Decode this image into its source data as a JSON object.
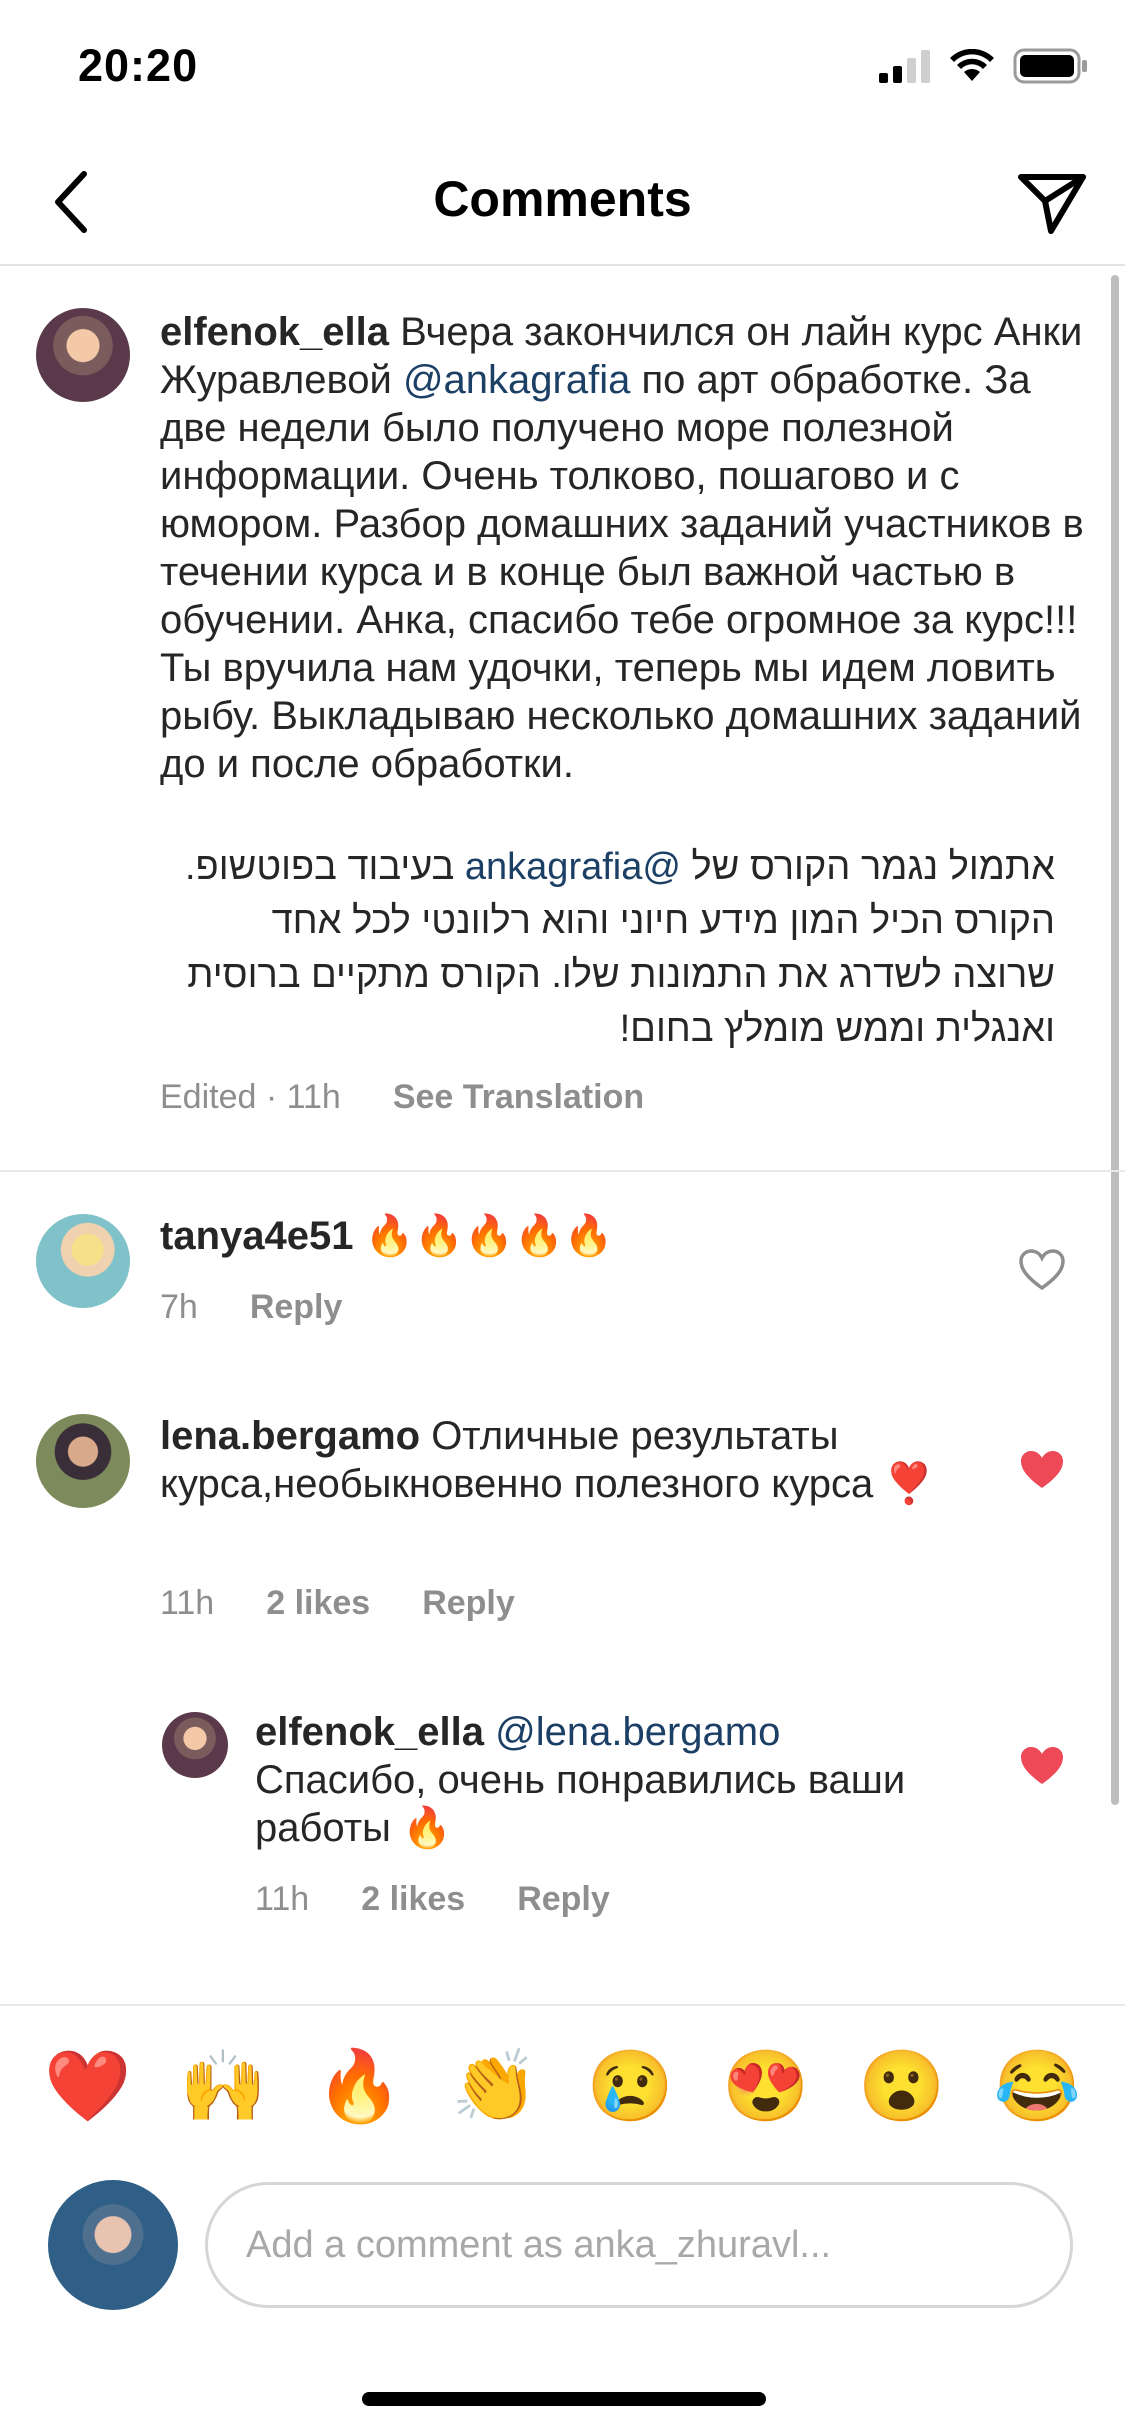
{
  "status_bar": {
    "time": "20:20"
  },
  "nav": {
    "title": "Comments"
  },
  "caption": {
    "username": "elfenok_ella",
    "text_before_mention": " Вчера закончился он лайн курс Анки Журавлевой ",
    "mention": "@ankagrafia",
    "text_after_mention": " по арт обработке. За две недели было получено море полезной информации. Очень толково, пошагово и с юмором. Разбор домашних заданий участников в течении курса и в конце был важной частью в обучении. Анка, спасибо тебе огромное за курс!!! Ты вручила нам удочки, теперь мы идем ловить рыбу. Выкладываю несколько домашних заданий до и после обработки.",
    "hebrew_line1_before": "אתמול נגמר הקורס של ",
    "hebrew_mention": "@ankagrafia",
    "hebrew_line1_after": " בעיבוד",
    "hebrew_rest": "בפוטשופ. הקורס הכיל המון מידע חיוני והוא רלוונטי לכל אחד שרוצה לשדרג את התמונות שלו. הקורס מתקיים ברוסית ואנגלית וממש מומלץ בחום!",
    "edited_time": "Edited · 11h",
    "see_translation": "See Translation"
  },
  "comments": [
    {
      "username": "tanya4e51",
      "text": " 🔥🔥🔥🔥🔥",
      "time": "7h",
      "reply": "Reply",
      "liked": false
    },
    {
      "username": "lena.bergamo",
      "text": " Отличные результаты курса,необыкновенно полезного курса ❣️",
      "time": "11h",
      "likes": "2 likes",
      "reply": "Reply",
      "liked": true
    }
  ],
  "reply_comment": {
    "username": "elfenok_ella",
    "mention": "@lena.bergamo",
    "text": "Спасибо, очень понравились ваши работы 🔥",
    "time": "11h",
    "likes": "2 likes",
    "reply": "Reply",
    "liked": true
  },
  "quick_emojis": [
    "❤️",
    "🙌",
    "🔥",
    "👏",
    "😢",
    "😍",
    "😮",
    "😂"
  ],
  "composer": {
    "placeholder": "Add a comment as anka_zhuravl..."
  },
  "colors": {
    "like_red": "#ed4956",
    "mention_blue": "#1c3f66",
    "meta_gray": "#8e8e8e"
  }
}
